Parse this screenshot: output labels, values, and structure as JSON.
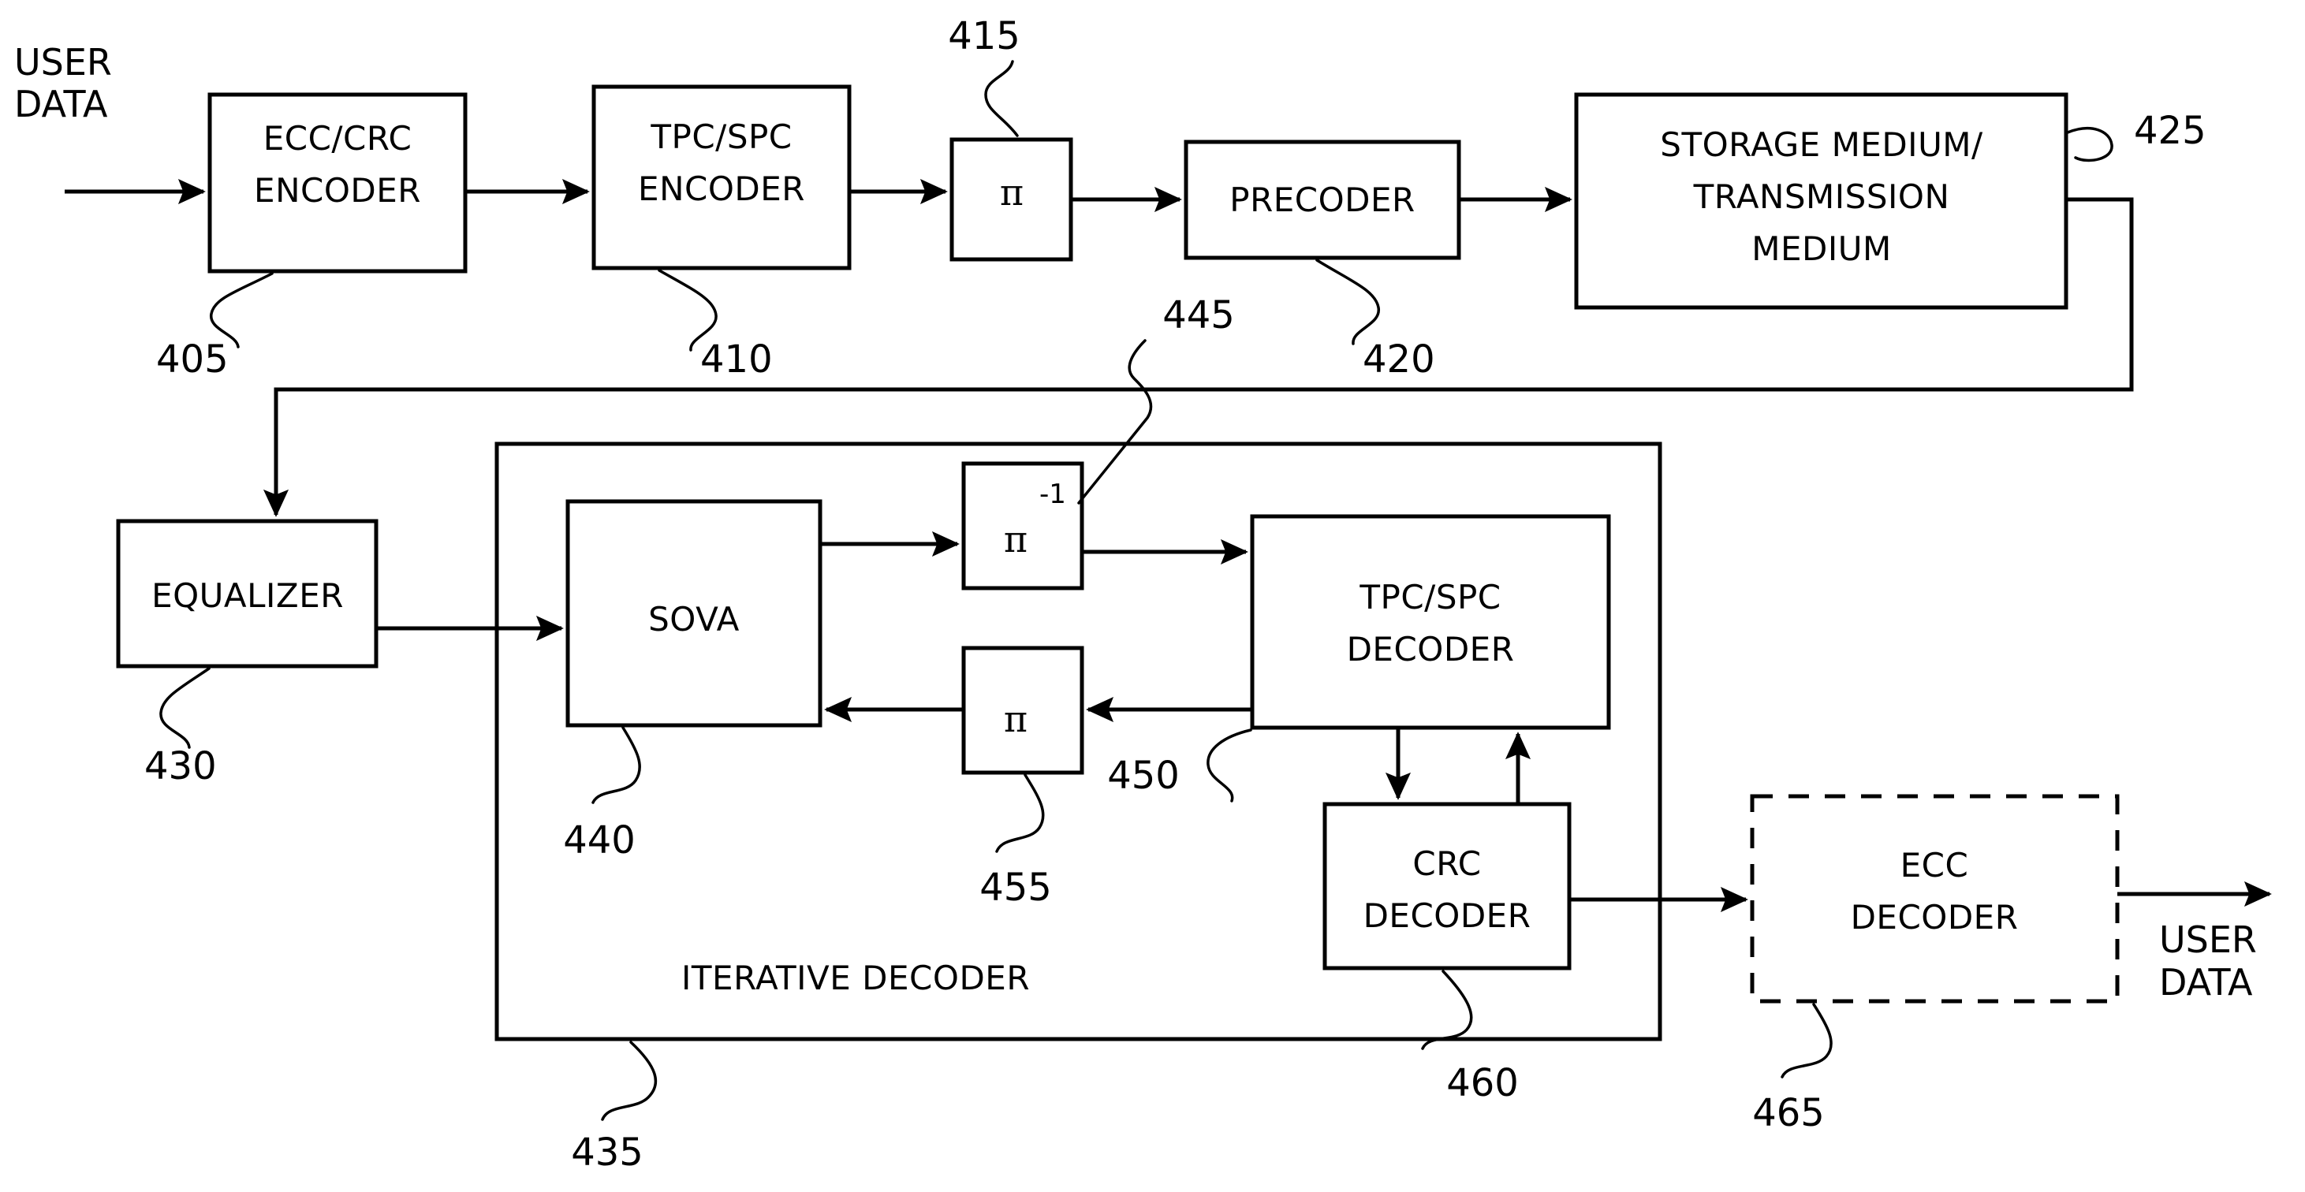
{
  "figure": {
    "type": "patent-block-diagram",
    "background_color": "#ffffff",
    "line_color": "#000000",
    "io_labels": {
      "input_user_data": "USER\nDATA",
      "input_user_data_line1": "USER",
      "input_user_data_line2": "DATA",
      "output_user_data_line1": "USER",
      "output_user_data_line2": "DATA"
    },
    "blocks": [
      {
        "id": "ecc_crc_encoder",
        "label_line1": "ECC/CRC",
        "label_line2": "ENCODER",
        "ref": "405",
        "style": "solid"
      },
      {
        "id": "tpc_spc_encoder",
        "label_line1": "TPC/SPC",
        "label_line2": "ENCODER",
        "ref": "410",
        "style": "solid"
      },
      {
        "id": "interleaver",
        "label_line1": "π",
        "label_line2": "",
        "ref": "415",
        "style": "solid"
      },
      {
        "id": "precoder",
        "label_line1": "PRECODER",
        "label_line2": "",
        "ref": "420",
        "style": "solid"
      },
      {
        "id": "storage_medium",
        "label_line1": "STORAGE MEDIUM/",
        "label_line2": "TRANSMISSION",
        "label_line3": "MEDIUM",
        "ref": "425",
        "style": "solid"
      },
      {
        "id": "equalizer",
        "label_line1": "EQUALIZER",
        "label_line2": "",
        "ref": "430",
        "style": "solid"
      },
      {
        "id": "iterative_decoder",
        "label_line1": "ITERATIVE DECODER",
        "label_line2": "",
        "ref": "435",
        "style": "solid-container"
      },
      {
        "id": "sova",
        "label_line1": "SOVA",
        "label_line2": "",
        "ref": "440",
        "style": "solid"
      },
      {
        "id": "deinterleaver",
        "label_line1": "π",
        "label_superscript": "-1",
        "label_line2": "",
        "ref": "445",
        "style": "solid"
      },
      {
        "id": "tpc_spc_decoder",
        "label_line1": "TPC/SPC",
        "label_line2": "DECODER",
        "ref": "450",
        "style": "solid"
      },
      {
        "id": "interleaver_feedback",
        "label_line1": "π",
        "label_line2": "",
        "ref": "455",
        "style": "solid"
      },
      {
        "id": "crc_decoder",
        "label_line1": "CRC",
        "label_line2": "DECODER",
        "ref": "460",
        "style": "solid"
      },
      {
        "id": "ecc_decoder",
        "label_line1": "ECC",
        "label_line2": "DECODER",
        "ref": "465",
        "style": "dashed"
      }
    ],
    "reference_numerals": [
      "405",
      "410",
      "415",
      "420",
      "425",
      "430",
      "435",
      "440",
      "445",
      "450",
      "455",
      "460",
      "465"
    ]
  }
}
